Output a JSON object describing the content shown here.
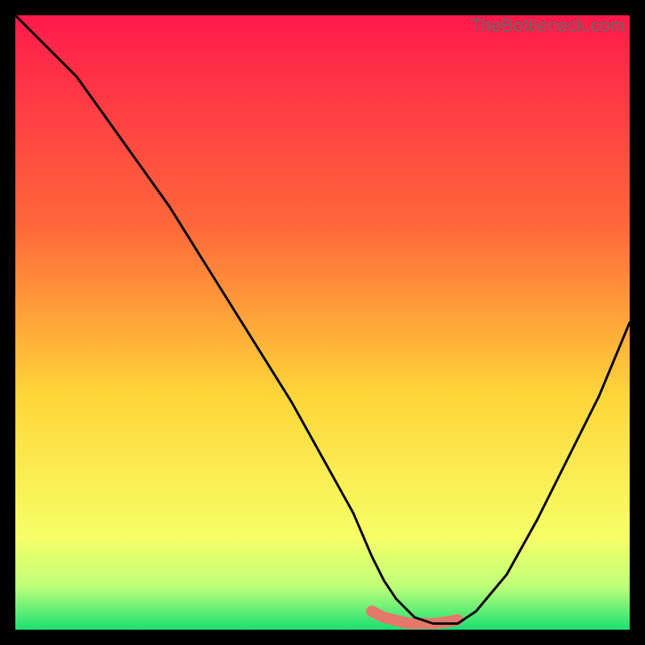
{
  "watermark": "TheBottleneck.com",
  "colors": {
    "gradient_top": "#ff1a4b",
    "gradient_mid1": "#ff6a3a",
    "gradient_mid2": "#ffd63a",
    "gradient_mid3": "#f6ff66",
    "gradient_mid4": "#beff7a",
    "gradient_bottom": "#19e072",
    "curve": "#000000",
    "accent": "#e5786d",
    "frame_bg": "#000000"
  },
  "chart_data": {
    "type": "line",
    "title": "",
    "xlabel": "",
    "ylabel": "",
    "xlim": [
      0,
      100
    ],
    "ylim": [
      0,
      100
    ],
    "grid": false,
    "legend": false,
    "series": [
      {
        "name": "bottleneck-curve",
        "x": [
          0,
          2,
          5,
          10,
          15,
          20,
          25,
          30,
          35,
          40,
          45,
          50,
          55,
          58,
          60,
          62,
          65,
          68,
          70,
          72,
          75,
          80,
          85,
          90,
          95,
          100
        ],
        "values": [
          100,
          98,
          95,
          90,
          83,
          76,
          69,
          61,
          53,
          45,
          37,
          28,
          19,
          12,
          8,
          5,
          2,
          1,
          1,
          1,
          3,
          9,
          18,
          28,
          38,
          50
        ]
      }
    ],
    "accent_segment": {
      "name": "optimal-range-marker",
      "x": [
        58,
        60,
        62,
        64,
        66,
        68,
        70,
        72
      ],
      "values": [
        3,
        2,
        1.5,
        1,
        1,
        1,
        1.2,
        1.6
      ]
    },
    "gradient_stops": [
      {
        "pos": 0.0,
        "color_key": "gradient_top"
      },
      {
        "pos": 0.35,
        "color_key": "gradient_mid1"
      },
      {
        "pos": 0.62,
        "color_key": "gradient_mid2"
      },
      {
        "pos": 0.85,
        "color_key": "gradient_mid3"
      },
      {
        "pos": 0.93,
        "color_key": "gradient_mid4"
      },
      {
        "pos": 1.0,
        "color_key": "gradient_bottom"
      }
    ]
  }
}
